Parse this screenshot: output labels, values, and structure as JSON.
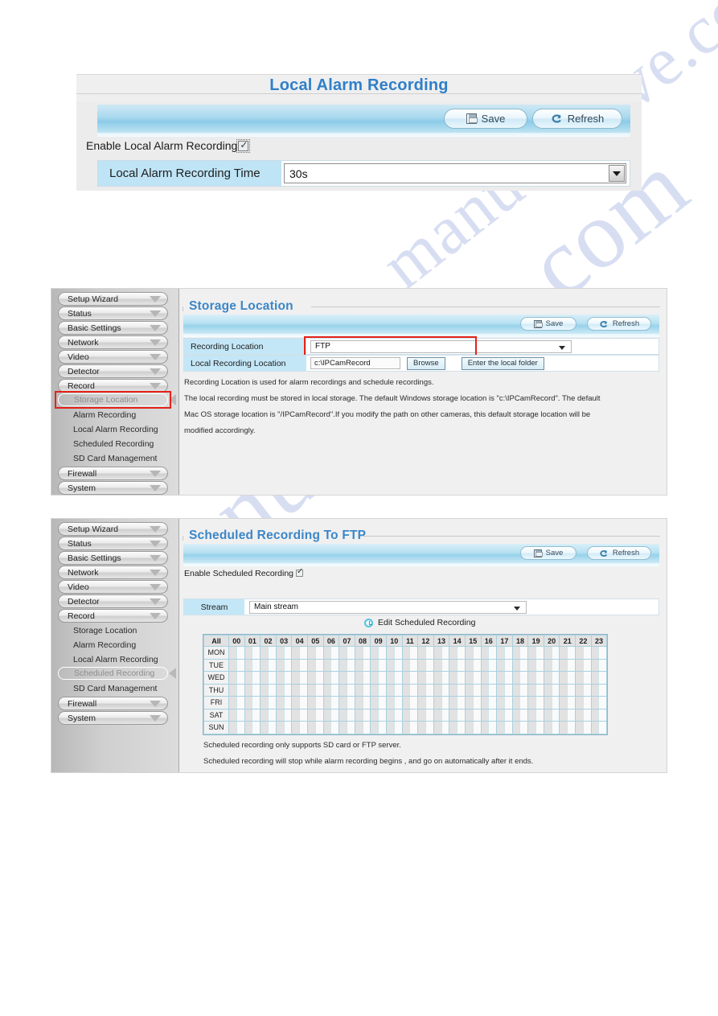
{
  "watermark": {
    "text_top": "manualshive.com",
    "text_bottom": "manualshive.com"
  },
  "panel1": {
    "title": "Local Alarm Recording",
    "toolbar": {
      "save_label": "Save",
      "refresh_label": "Refresh"
    },
    "enable_label": "Enable Local Alarm Recording",
    "enable_checked": "checked",
    "field_label": "Local Alarm Recording Time",
    "field_value": "30s"
  },
  "panel2": {
    "legend_title": "Storage Location",
    "toolbar": {
      "save_label": "Save",
      "refresh_label": "Refresh"
    },
    "sidebar": {
      "groups": [
        {
          "label": "Setup Wizard"
        },
        {
          "label": "Status"
        },
        {
          "label": "Basic Settings"
        },
        {
          "label": "Network"
        },
        {
          "label": "Video"
        },
        {
          "label": "Detector"
        },
        {
          "label": "Record"
        }
      ],
      "subitems": [
        {
          "label": "Storage Location",
          "selected": true
        },
        {
          "label": "Alarm Recording",
          "selected": false
        },
        {
          "label": "Local Alarm Recording",
          "selected": false
        },
        {
          "label": "Scheduled Recording",
          "selected": false
        },
        {
          "label": "SD Card Management",
          "selected": false
        }
      ],
      "groups_bottom": [
        {
          "label": "Firewall"
        },
        {
          "label": "System"
        }
      ]
    },
    "rows": [
      {
        "label": "Recording Location",
        "value": "FTP",
        "highlighted": true
      },
      {
        "label": "Local Recording Location",
        "value": "c:\\IPCamRecord"
      }
    ],
    "browse_label": "Browse",
    "enter_folder_label": "Enter the local folder",
    "notes": [
      "Recording Location is used for alarm recordings and schedule recordings.",
      "The local recording must be stored in local storage. The default Windows storage location is \"c:\\IPCamRecord\". The default",
      "Mac OS storage location is \"/IPCamRecord\".If you modify the path on other cameras, this default storage location will be",
      "modified accordingly."
    ]
  },
  "panel3": {
    "legend_title": "Scheduled Recording To FTP",
    "toolbar": {
      "save_label": "Save",
      "refresh_label": "Refresh"
    },
    "sidebar": {
      "groups": [
        {
          "label": "Setup Wizard"
        },
        {
          "label": "Status"
        },
        {
          "label": "Basic Settings"
        },
        {
          "label": "Network"
        },
        {
          "label": "Video"
        },
        {
          "label": "Detector"
        },
        {
          "label": "Record"
        }
      ],
      "subitems": [
        {
          "label": "Storage Location",
          "selected": false
        },
        {
          "label": "Alarm Recording",
          "selected": false
        },
        {
          "label": "Local Alarm Recording",
          "selected": false
        },
        {
          "label": "Scheduled Recording",
          "selected": true
        },
        {
          "label": "SD Card Management",
          "selected": false
        }
      ],
      "groups_bottom": [
        {
          "label": "Firewall"
        },
        {
          "label": "System"
        }
      ]
    },
    "enable_label": "Enable Scheduled Recording",
    "enable_checked": "checked",
    "stream_label": "Stream",
    "stream_value": "Main stream",
    "edit_schedule_label": "Edit Scheduled Recording",
    "schedule": {
      "all_label": "All",
      "hours": [
        "00",
        "01",
        "02",
        "03",
        "04",
        "05",
        "06",
        "07",
        "08",
        "09",
        "10",
        "11",
        "12",
        "13",
        "14",
        "15",
        "16",
        "17",
        "18",
        "19",
        "20",
        "21",
        "22",
        "23"
      ],
      "days": [
        "MON",
        "TUE",
        "WED",
        "THU",
        "FRI",
        "SAT",
        "SUN"
      ],
      "selected_cells": []
    },
    "notes": [
      "Scheduled recording only supports SD card or FTP server.",
      "Scheduled recording will stop while alarm recording begins ,  and go on automatically after it ends."
    ]
  }
}
